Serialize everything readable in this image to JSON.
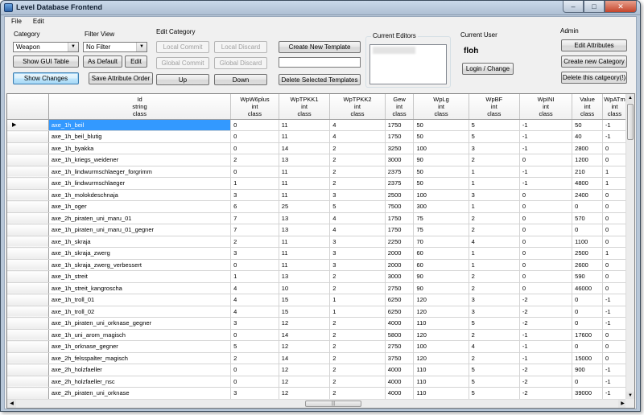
{
  "window": {
    "title": "Level Database Frontend"
  },
  "menu": [
    {
      "label": "File"
    },
    {
      "label": "Edit"
    }
  ],
  "category": {
    "label": "Category",
    "value": "Weapon"
  },
  "filter_view": {
    "label": "Filter View",
    "value": "No Filter"
  },
  "buttons": {
    "show_gui_table": "Show GUI Table",
    "as_default": "As Default",
    "edit": "Edit",
    "show_changes": "Show Changes",
    "save_attribute_order": "Save Attribute Order"
  },
  "edit_category": {
    "label": "Edit Category",
    "local_commit": "Local Commit",
    "local_discard": "Local Discard",
    "global_commit": "Global Commit",
    "global_discard": "Global Discard",
    "up": "Up",
    "down": "Down",
    "create_new_template": "Create New Template",
    "template_name_value": "",
    "delete_selected_templates": "Delete Selected Templates"
  },
  "current_editors": {
    "label": "Current Editors"
  },
  "current_user": {
    "label": "Current User",
    "name": "floh",
    "login_change": "Login / Change"
  },
  "admin": {
    "label": "Admin",
    "edit_attributes": "Edit Attributes",
    "create_new_category": "Create new Category",
    "delete_category": "Delete this catgeory(!)"
  },
  "grid": {
    "columns": [
      {
        "name": "Id",
        "type": "string",
        "kind": "class"
      },
      {
        "name": "WpW6plus",
        "type": "int",
        "kind": "class"
      },
      {
        "name": "WpTPKK1",
        "type": "int",
        "kind": "class"
      },
      {
        "name": "WpTPKK2",
        "type": "int",
        "kind": "class"
      },
      {
        "name": "Gew",
        "type": "int",
        "kind": "class"
      },
      {
        "name": "WpLg",
        "type": "int",
        "kind": "class"
      },
      {
        "name": "WpBF",
        "type": "int",
        "kind": "class"
      },
      {
        "name": "WpINI",
        "type": "int",
        "kind": "class"
      },
      {
        "name": "Value",
        "type": "int",
        "kind": "class"
      },
      {
        "name": "WpATm",
        "type": "int",
        "kind": "class"
      }
    ],
    "current_row_marker": "▶",
    "rows": [
      [
        "axe_1h_beil",
        "0",
        "11",
        "4",
        "1750",
        "50",
        "5",
        "-1",
        "50",
        "-1"
      ],
      [
        "axe_1h_beil_blutig",
        "0",
        "11",
        "4",
        "1750",
        "50",
        "5",
        "-1",
        "40",
        "-1"
      ],
      [
        "axe_1h_byakka",
        "0",
        "14",
        "2",
        "3250",
        "100",
        "3",
        "-1",
        "2800",
        "0"
      ],
      [
        "axe_1h_kriegs_weidener",
        "2",
        "13",
        "2",
        "3000",
        "90",
        "2",
        "0",
        "1200",
        "0"
      ],
      [
        "axe_1h_lindwurmschlaeger_forgrimm",
        "0",
        "11",
        "2",
        "2375",
        "50",
        "1",
        "-1",
        "210",
        "1"
      ],
      [
        "axe_1h_lindwurmschlaeger",
        "1",
        "11",
        "2",
        "2375",
        "50",
        "1",
        "-1",
        "4800",
        "1"
      ],
      [
        "axe_1h_molokdeschnaja",
        "3",
        "11",
        "3",
        "2500",
        "100",
        "3",
        "0",
        "2400",
        "0"
      ],
      [
        "axe_1h_oger",
        "6",
        "25",
        "5",
        "7500",
        "300",
        "1",
        "0",
        "0",
        "0"
      ],
      [
        "axe_2h_piraten_uni_maru_01",
        "7",
        "13",
        "4",
        "1750",
        "75",
        "2",
        "0",
        "570",
        "0"
      ],
      [
        "axe_1h_piraten_uni_maru_01_gegner",
        "7",
        "13",
        "4",
        "1750",
        "75",
        "2",
        "0",
        "0",
        "0"
      ],
      [
        "axe_1h_skraja",
        "2",
        "11",
        "3",
        "2250",
        "70",
        "4",
        "0",
        "1100",
        "0"
      ],
      [
        "axe_1h_skraja_zwerg",
        "3",
        "11",
        "3",
        "2000",
        "60",
        "1",
        "0",
        "2500",
        "1"
      ],
      [
        "axe_1h_skraja_zwerg_verbessert",
        "0",
        "11",
        "3",
        "2000",
        "60",
        "1",
        "0",
        "2600",
        "0"
      ],
      [
        "axe_1h_streit",
        "1",
        "13",
        "2",
        "3000",
        "90",
        "2",
        "0",
        "590",
        "0"
      ],
      [
        "axe_1h_streit_kangroscha",
        "4",
        "10",
        "2",
        "2750",
        "90",
        "2",
        "0",
        "46000",
        "0"
      ],
      [
        "axe_1h_troll_01",
        "4",
        "15",
        "1",
        "6250",
        "120",
        "3",
        "-2",
        "0",
        "-1"
      ],
      [
        "axe_1h_troll_02",
        "4",
        "15",
        "1",
        "6250",
        "120",
        "3",
        "-2",
        "0",
        "-1"
      ],
      [
        "axe_1h_piraten_uni_orknase_gegner",
        "3",
        "12",
        "2",
        "4000",
        "110",
        "5",
        "-2",
        "0",
        "-1"
      ],
      [
        "axe_1h_uni_arom_magisch",
        "0",
        "14",
        "2",
        "5800",
        "120",
        "2",
        "-1",
        "17600",
        "0"
      ],
      [
        "axe_1h_orknase_gegner",
        "5",
        "12",
        "2",
        "2750",
        "100",
        "4",
        "-1",
        "0",
        "0"
      ],
      [
        "axe_2h_felsspalter_magisch",
        "2",
        "14",
        "2",
        "3750",
        "120",
        "2",
        "-1",
        "15000",
        "0"
      ],
      [
        "axe_2h_holzfaeller",
        "0",
        "12",
        "2",
        "4000",
        "110",
        "5",
        "-2",
        "900",
        "-1"
      ],
      [
        "axe_2h_holzfaeller_nsc",
        "0",
        "12",
        "2",
        "4000",
        "110",
        "5",
        "-2",
        "0",
        "-1"
      ],
      [
        "axe_2h_piraten_uni_orknase",
        "3",
        "12",
        "2",
        "4000",
        "110",
        "5",
        "-2",
        "39000",
        "-1"
      ]
    ]
  },
  "scrollbar": {
    "grip": "|||"
  },
  "colors": {
    "selection": "#3399ff",
    "window_frame": "#b8c7d8"
  }
}
